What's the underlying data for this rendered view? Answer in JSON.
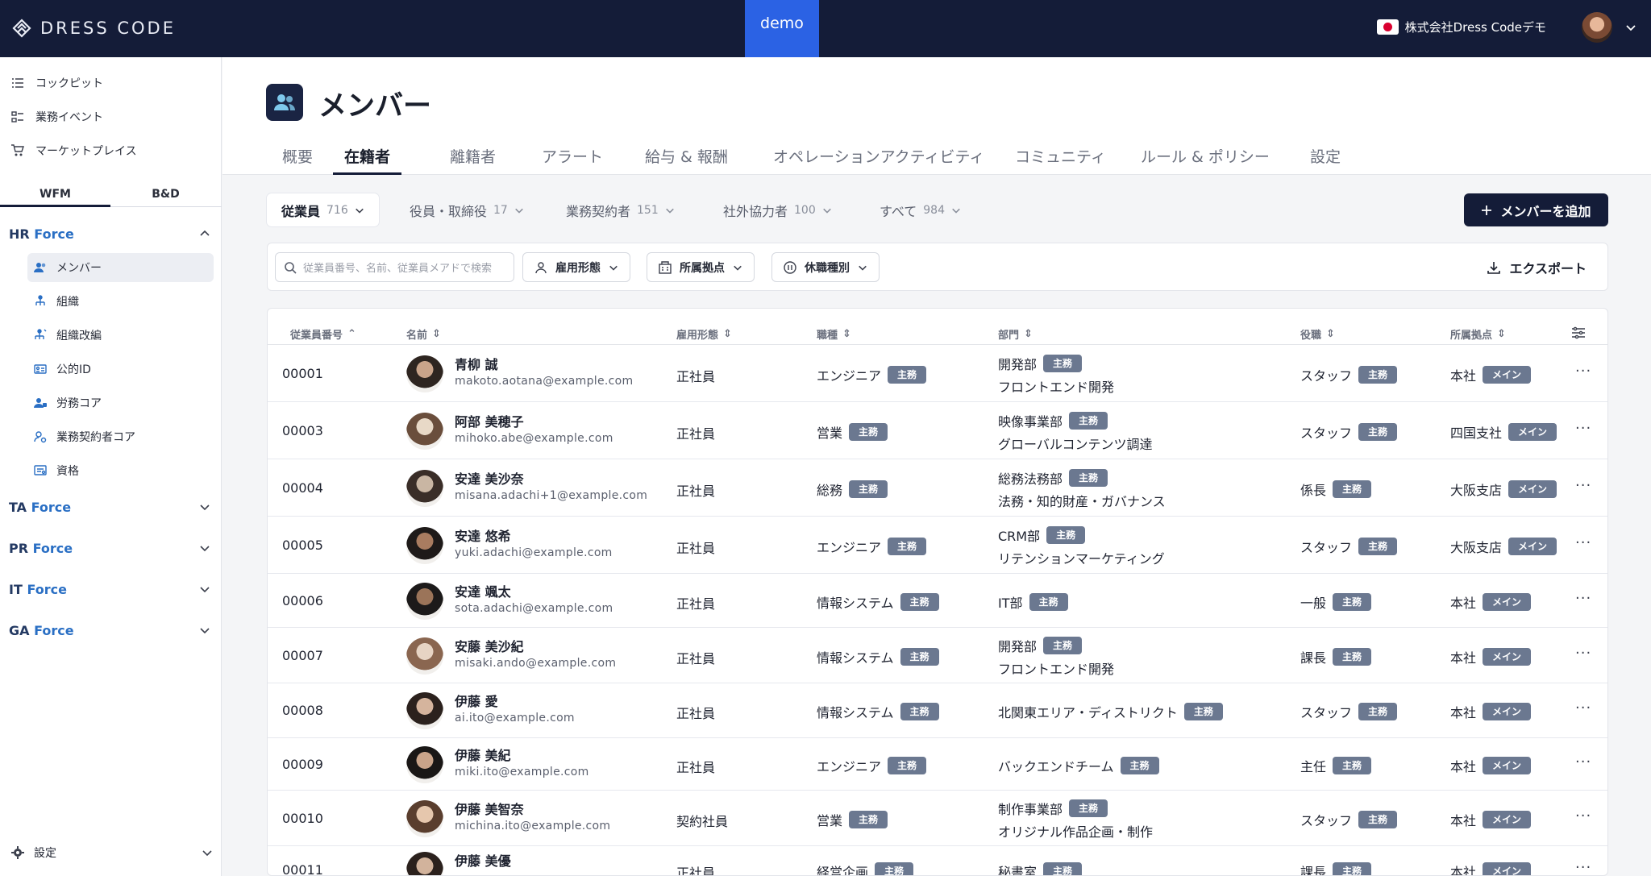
{
  "topbar": {
    "brand": "DRESS CODE",
    "env": "demo",
    "company": "株式会社Dress Codeデモ"
  },
  "sidebar": {
    "links": [
      "コックピット",
      "業務イベント",
      "マーケットプレイス"
    ],
    "tabs": [
      "WFM",
      "B&D"
    ],
    "groups": [
      {
        "prefix": "HR",
        "name": "Force"
      },
      {
        "prefix": "TA",
        "name": "Force"
      },
      {
        "prefix": "PR",
        "name": "Force"
      },
      {
        "prefix": "IT",
        "name": "Force"
      },
      {
        "prefix": "GA",
        "name": "Force"
      }
    ],
    "hr_items": [
      "メンバー",
      "組織",
      "組織改編",
      "公的ID",
      "労務コア",
      "業務契約者コア",
      "資格"
    ],
    "settings": "設定"
  },
  "page": {
    "title": "メンバー",
    "tabs": [
      "概要",
      "在籍者",
      "離籍者",
      "アラート",
      "給与 & 報酬",
      "オペレーションアクティビティ",
      "コミュニティ",
      "ルール & ポリシー",
      "設定"
    ]
  },
  "chips": [
    {
      "label": "従業員",
      "count": "716"
    },
    {
      "label": "役員・取締役",
      "count": "17"
    },
    {
      "label": "業務契約者",
      "count": "151"
    },
    {
      "label": "社外協力者",
      "count": "100"
    },
    {
      "label": "すべて",
      "count": "984"
    }
  ],
  "add_button": "メンバーを追加",
  "filters": {
    "search_placeholder": "従業員番号、名前、従業員メアドで検索",
    "buttons": [
      "雇用形態",
      "所属拠点",
      "休職種別"
    ],
    "export": "エクスポート"
  },
  "table": {
    "headers": [
      "従業員番号",
      "名前",
      "雇用形態",
      "職種",
      "部門",
      "役職",
      "所属拠点"
    ],
    "rows": [
      {
        "id": "00001",
        "name": "青柳 誠",
        "email": "makoto.aotana@example.com",
        "emp": "正社員",
        "job": "エンジニア",
        "job_tag": "主務",
        "dept": "開発部",
        "dept_tag": "主務",
        "dept2": "フロントエンド開発",
        "pos": "スタッフ",
        "pos_tag": "主務",
        "loc": "本社",
        "loc_tag": "メイン"
      },
      {
        "id": "00003",
        "name": "阿部 美穂子",
        "email": "mihoko.abe@example.com",
        "emp": "正社員",
        "job": "営業",
        "job_tag": "主務",
        "dept": "映像事業部",
        "dept_tag": "主務",
        "dept2": "グローバルコンテンツ調達",
        "pos": "スタッフ",
        "pos_tag": "主務",
        "loc": "四国支社",
        "loc_tag": "メイン"
      },
      {
        "id": "00004",
        "name": "安達 美沙奈",
        "email": "misana.adachi+1@example.com",
        "emp": "正社員",
        "job": "総務",
        "job_tag": "主務",
        "dept": "総務法務部",
        "dept_tag": "主務",
        "dept2": "法務・知的財産・ガバナンス",
        "pos": "係長",
        "pos_tag": "主務",
        "loc": "大阪支店",
        "loc_tag": "メイン"
      },
      {
        "id": "00005",
        "name": "安達 悠希",
        "email": "yuki.adachi@example.com",
        "emp": "正社員",
        "job": "エンジニア",
        "job_tag": "主務",
        "dept": "CRM部",
        "dept_tag": "主務",
        "dept2": "リテンションマーケティング",
        "pos": "スタッフ",
        "pos_tag": "主務",
        "loc": "大阪支店",
        "loc_tag": "メイン"
      },
      {
        "id": "00006",
        "name": "安達 颯太",
        "email": "sota.adachi@example.com",
        "emp": "正社員",
        "job": "情報システム",
        "job_tag": "主務",
        "dept": "IT部",
        "dept_tag": "主務",
        "dept2": "",
        "pos": "一般",
        "pos_tag": "主務",
        "loc": "本社",
        "loc_tag": "メイン"
      },
      {
        "id": "00007",
        "name": "安藤 美沙紀",
        "email": "misaki.ando@example.com",
        "emp": "正社員",
        "job": "情報システム",
        "job_tag": "主務",
        "dept": "開発部",
        "dept_tag": "主務",
        "dept2": "フロントエンド開発",
        "pos": "課長",
        "pos_tag": "主務",
        "loc": "本社",
        "loc_tag": "メイン"
      },
      {
        "id": "00008",
        "name": "伊藤 愛",
        "email": "ai.ito@example.com",
        "emp": "正社員",
        "job": "情報システム",
        "job_tag": "主務",
        "dept": "北関東エリア・ディストリクト",
        "dept_tag": "主務",
        "dept2": "",
        "pos": "スタッフ",
        "pos_tag": "主務",
        "loc": "本社",
        "loc_tag": "メイン"
      },
      {
        "id": "00009",
        "name": "伊藤 美紀",
        "email": "miki.ito@example.com",
        "emp": "正社員",
        "job": "エンジニア",
        "job_tag": "主務",
        "dept": "バックエンドチーム",
        "dept_tag": "主務",
        "dept2": "",
        "pos": "主任",
        "pos_tag": "主務",
        "loc": "本社",
        "loc_tag": "メイン"
      },
      {
        "id": "00010",
        "name": "伊藤 美智奈",
        "email": "michina.ito@example.com",
        "emp": "契約社員",
        "job": "営業",
        "job_tag": "主務",
        "dept": "制作事業部",
        "dept_tag": "主務",
        "dept2": "オリジナル作品企画・制作",
        "pos": "スタッフ",
        "pos_tag": "主務",
        "loc": "本社",
        "loc_tag": "メイン"
      },
      {
        "id": "00011",
        "name": "伊藤 美優",
        "email": "",
        "emp": "正社員",
        "job": "経営企画",
        "job_tag": "主務",
        "dept": "秘書室",
        "dept_tag": "主務",
        "dept2": "",
        "pos": "課長",
        "pos_tag": "主務",
        "loc": "本社",
        "loc_tag": "メイン"
      }
    ]
  }
}
